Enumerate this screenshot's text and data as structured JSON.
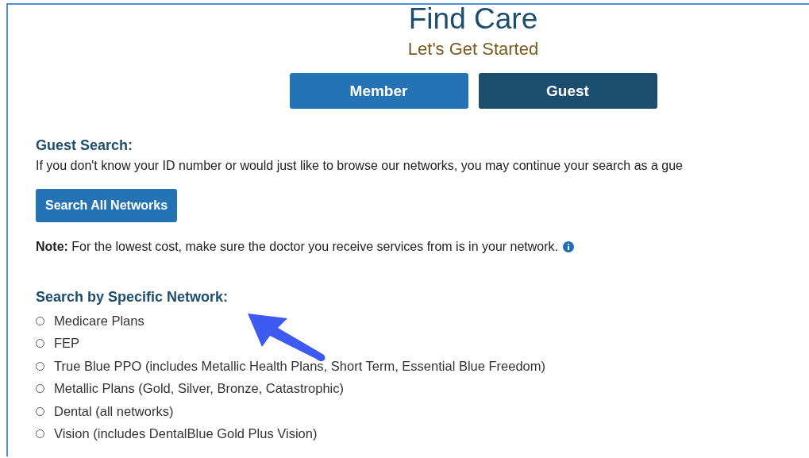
{
  "header": {
    "title": "Find Care",
    "subtitle": "Let's Get Started"
  },
  "modes": [
    {
      "label": "Member",
      "selected": false
    },
    {
      "label": "Guest",
      "selected": true
    }
  ],
  "guest_search": {
    "heading": "Guest Search:",
    "description": "If you don't know your ID number or would just like to browse our networks, you may continue your search as a gue",
    "button": "Search All Networks"
  },
  "note": {
    "text": "**Note:** For the lowest cost, make sure the doctor you receive services from is in your network."
  },
  "network_search": {
    "heading": "Search by Specific Network:",
    "options": [
      {
        "label": "Medicare Plans",
        "selected": false
      },
      {
        "label": "FEP",
        "selected": false
      },
      {
        "label": "True Blue PPO (includes Metallic Health Plans, Short Term, Essential Blue Freedom)",
        "selected": false
      },
      {
        "label": "Metallic Plans (Gold, Silver, Bronze, Catastrophic)",
        "selected": false
      },
      {
        "label": "Dental (all networks)",
        "selected": false
      },
      {
        "label": "Vision (includes DentalBlue Gold Plus Vision)",
        "selected": false
      }
    ]
  }
}
